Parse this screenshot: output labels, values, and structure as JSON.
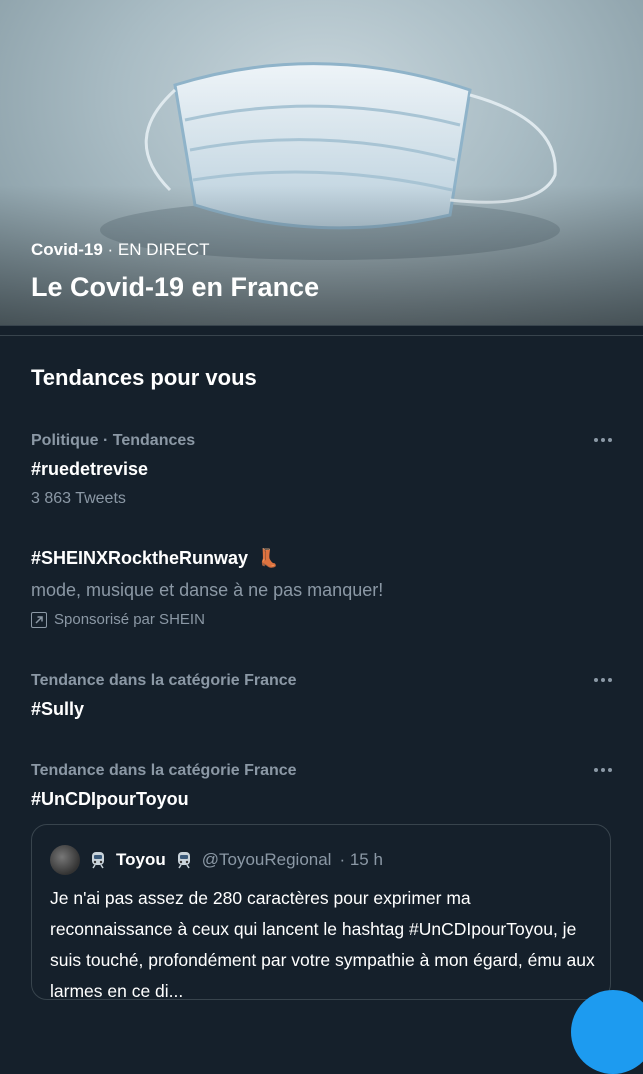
{
  "hero": {
    "category": "Covid-19",
    "status": "· EN DIRECT",
    "title": "Le Covid-19 en France"
  },
  "section": {
    "title": "Tendances pour vous"
  },
  "trends": [
    {
      "meta": "Politique · Tendances",
      "name": "#ruedetrevise",
      "count": "3 863 Tweets"
    },
    {
      "name": "#SHEINXRocktheRunway",
      "emoji": "👢",
      "description": "mode, musique et danse à ne pas manquer!",
      "sponsor": "Sponsorisé par SHEIN"
    },
    {
      "meta": "Tendance dans la catégorie France",
      "name": "#Sully"
    },
    {
      "meta": "Tendance dans la catégorie France",
      "name": "#UnCDIpourToyou"
    }
  ],
  "tweet": {
    "name": "Toyou",
    "handle": "@ToyouRegional",
    "time": "· 15 h",
    "text": "Je n'ai pas assez de 280 caractères pour exprimer ma reconnaissance à ceux qui lancent le hashtag #UnCDIpourToyou, je suis touché, profondément par votre sympathie à mon égard, ému aux larmes en ce di..."
  },
  "colors": {
    "background": "#15202b",
    "accent": "#1d9bf0",
    "muted": "#8b98a5",
    "border": "#38444d"
  }
}
